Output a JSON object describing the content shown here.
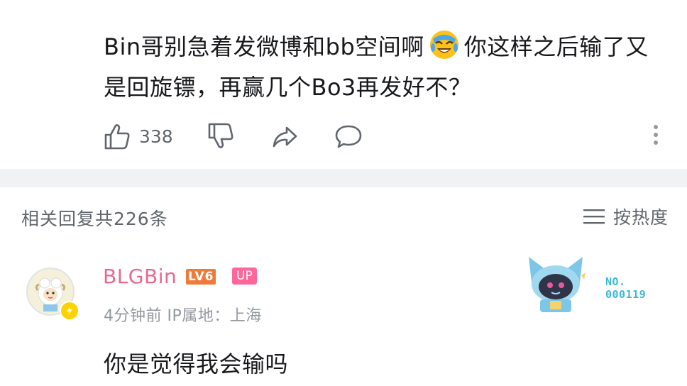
{
  "comment": {
    "text_part1": "Bin哥别急着发微博和bb空间啊",
    "emoji": "crying-laughing-emoji",
    "text_part2": "你这样之后输了又是回旋镖，再赢几个Bo3再发好不？",
    "like_count": "338"
  },
  "replies": {
    "header": "相关回复共226条",
    "sort_label": "按热度"
  },
  "reply": {
    "username": "BLGBin",
    "level_badge": "LV6",
    "up_badge": "UP",
    "time": "4分钟前",
    "ip_location": "IP属地：上海",
    "fan_number_label": "NO.",
    "fan_number": "000119",
    "text": "你是觉得我会输吗"
  },
  "colors": {
    "username": "#e8698f",
    "level": "#ef7a3a",
    "up": "#ff6699",
    "fan_number": "#3db8d8",
    "secondary_text": "#61666d"
  }
}
